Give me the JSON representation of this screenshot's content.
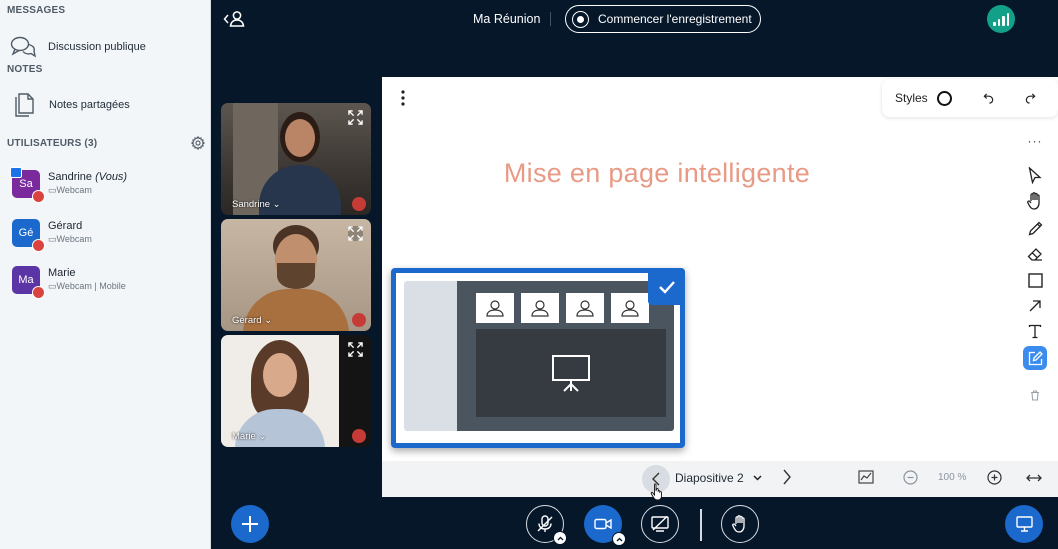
{
  "sidebar": {
    "messages_title": "MESSAGES",
    "public_chat": "Discussion publique",
    "notes_title": "NOTES",
    "shared_notes": "Notes partagées",
    "users_title": "UTILISATEURS (3)",
    "users": [
      {
        "initials": "Sa",
        "name": "Sandrine",
        "you": "(Vous)",
        "sub": "Webcam",
        "color": "#7a2a9c"
      },
      {
        "initials": "Gé",
        "name": "Gérard",
        "you": "",
        "sub": "Webcam",
        "color": "#1b69cc"
      },
      {
        "initials": "Ma",
        "name": "Marie",
        "you": "",
        "sub": "Webcam | Mobile",
        "color": "#5b35a6"
      }
    ]
  },
  "topbar": {
    "meeting_title": "Ma Réunion",
    "record_label": "Commencer l'enregistrement"
  },
  "videos": [
    {
      "name": "Sandrine"
    },
    {
      "name": "Gérard"
    },
    {
      "name": "Marie"
    }
  ],
  "whiteboard": {
    "styles_label": "Styles",
    "slide_title": "Mise en page intelligente",
    "slide_label": "Diapositive 2",
    "zoom": "100 %"
  },
  "colors": {
    "accent": "#1b69cc",
    "background": "#06172a",
    "title_color": "#e89a85",
    "connection": "#12a089",
    "mute": "#d9433f"
  }
}
